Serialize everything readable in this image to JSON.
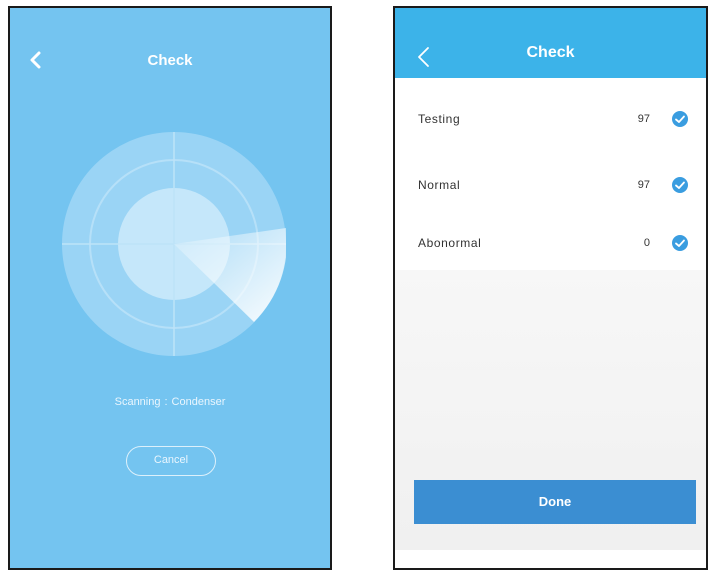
{
  "left_screen": {
    "title": "Check",
    "scan_status_label": "Scanning",
    "scan_separator": ":",
    "scan_component": "Condenser",
    "cancel_label": "Cancel",
    "colors": {
      "background": "#74c4f0",
      "radar_outer": "#9ad4f5",
      "radar_inner": "#c5e7fa"
    },
    "icons": {
      "back": "chevron-left-icon"
    }
  },
  "right_screen": {
    "title": "Check",
    "results": [
      {
        "label": "Testing",
        "count": "97"
      },
      {
        "label": "Normal",
        "count": "97"
      },
      {
        "label": "Abonormal",
        "count": "0"
      }
    ],
    "done_label": "Done",
    "colors": {
      "header": "#3cb3e9",
      "done_button": "#3b8ed2",
      "check": "#3a9de0"
    },
    "icons": {
      "back": "chevron-left-icon",
      "status": "check-circle-icon"
    }
  }
}
